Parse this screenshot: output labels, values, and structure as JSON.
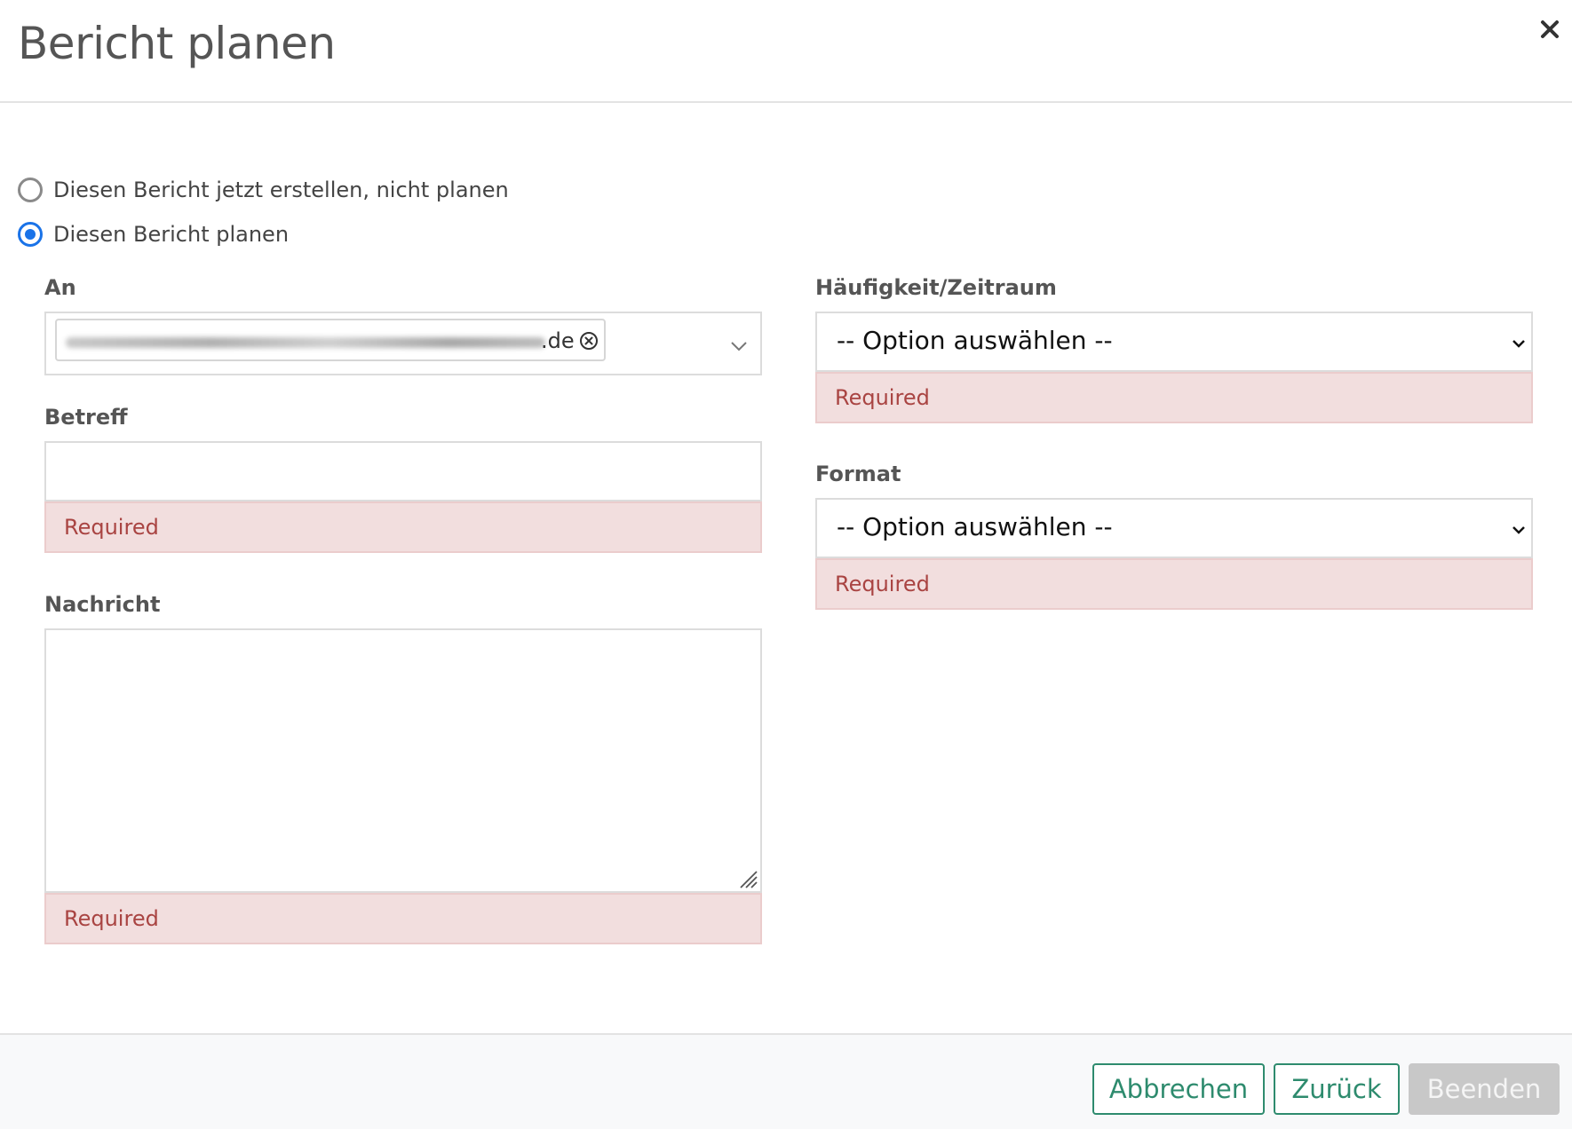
{
  "dialog": {
    "title": "Bericht planen",
    "close_icon": "close-icon"
  },
  "mode": {
    "options": [
      {
        "label": "Diesen Bericht jetzt erstellen, nicht planen",
        "selected": false
      },
      {
        "label": "Diesen Bericht planen",
        "selected": true
      }
    ]
  },
  "form": {
    "to": {
      "label": "An",
      "recipient_suffix": ".de"
    },
    "subject": {
      "label": "Betreff",
      "value": "",
      "error": "Required"
    },
    "message": {
      "label": "Nachricht",
      "value": "",
      "error": "Required"
    },
    "frequency": {
      "label": "Häufigkeit/Zeitraum",
      "selected": "-- Option auswählen --",
      "error": "Required"
    },
    "format": {
      "label": "Format",
      "selected": "-- Option auswählen --",
      "error": "Required"
    }
  },
  "footer": {
    "cancel_label": "Abbrechen",
    "back_label": "Zurück",
    "finish_label": "Beenden"
  },
  "colors": {
    "accent": "#1a73e8",
    "button_green": "#2e8b6e",
    "error_bg": "#f2dede",
    "error_text": "#a94442"
  }
}
